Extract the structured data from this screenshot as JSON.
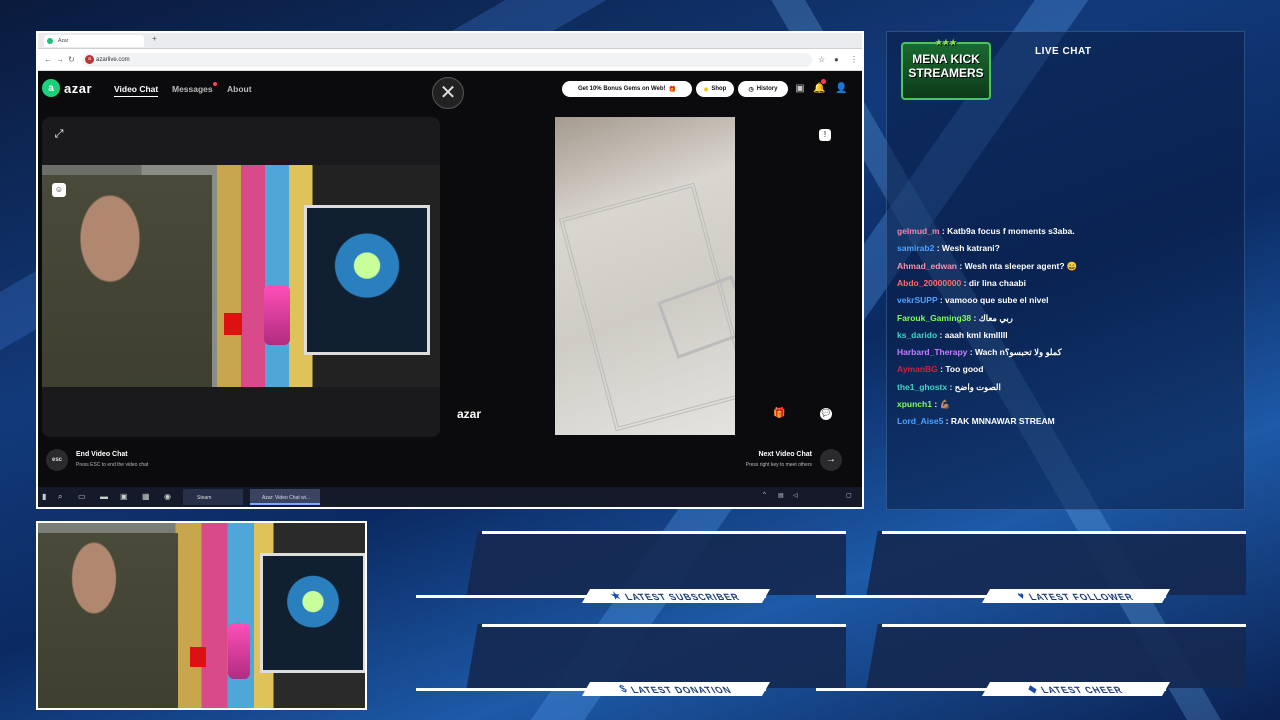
{
  "browser": {
    "tab_title": "Azar",
    "url": "azarlive.com"
  },
  "azar": {
    "logo": "azar",
    "logo_mark": "a",
    "nav": {
      "video_chat": "Video Chat",
      "messages": "Messages",
      "about": "About"
    },
    "gems_pill": "Get 10% Bonus Gems on Web!",
    "shop": "Shop",
    "history": "History",
    "watermark": "azar",
    "watermark_sub": "",
    "end_title": "End Video Chat",
    "end_sub": "Press ESC to end the video chat",
    "esc": "esc",
    "next_title": "Next Video Chat",
    "next_sub": "Press right key to meet others"
  },
  "taskbar": {
    "steam": "Steam",
    "azar": "Azar: Video Chat wi...",
    "time": "",
    "date": ""
  },
  "chat": {
    "badge_line1": "MENA KICK",
    "badge_line2": "STREAMERS",
    "title": "LIVE CHAT",
    "messages": [
      {
        "user": "gelmud_m",
        "color": "#ff7fb0",
        "text": "Katb9a focus f moments s3aba."
      },
      {
        "user": "samirab2",
        "color": "#4aa3ff",
        "text": "Wesh katrani?"
      },
      {
        "user": "Ahmad_edwan",
        "color": "#ff8fb0",
        "text": "Wesh nta sleeper agent? 😄"
      },
      {
        "user": "Abdo_20000000",
        "color": "#ff6b6b",
        "text": "dir lina chaabi"
      },
      {
        "user": "vekrSUPP",
        "color": "#4aa3ff",
        "text": "vamooo que sube el nivel"
      },
      {
        "user": "Farouk_Gaming38",
        "color": "#7dff5a",
        "text": "ربي معاك"
      },
      {
        "user": "ks_darido",
        "color": "#3dd6c6",
        "text": "aaah kml kmlllll"
      },
      {
        "user": "Harbard_Therapy",
        "color": "#c77dff",
        "text": "Wach nكملو ولا تحبسو؟"
      },
      {
        "user": "AymanBG",
        "color": "#d61f3a",
        "text": "Too good"
      },
      {
        "user": "the1_ghostx",
        "color": "#3dd6c6",
        "text": "الصوت واضح"
      },
      {
        "user": "xpunch1",
        "color": "#7dff5a",
        "text": "💪🏽"
      },
      {
        "user": "Lord_Aise5",
        "color": "#4aa3ff",
        "text": "RAK MNNAWAR STREAM"
      }
    ]
  },
  "alerts": {
    "subscriber": "LATEST SUBSCRIBER",
    "follower": "LATEST FOLLOWER",
    "donation": "LATEST DONATION",
    "cheer": "LATEST CHEER"
  }
}
